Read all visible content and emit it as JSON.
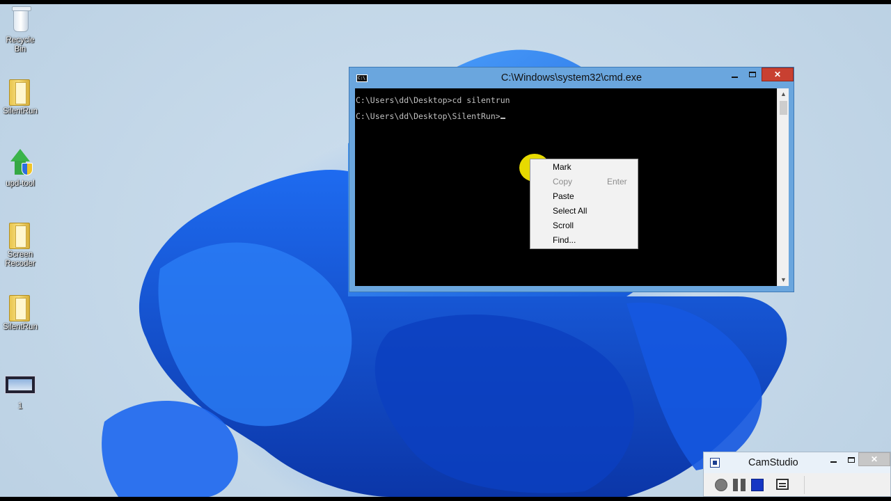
{
  "desktop": {
    "icons": [
      {
        "label": "Recycle Bin",
        "icon": "recycle-bin-icon"
      },
      {
        "label": "SilentRun",
        "icon": "folder-icon"
      },
      {
        "label": "upd-tool",
        "icon": "update-shield-icon"
      },
      {
        "label": "Screen Recoder",
        "icon": "folder-icon"
      },
      {
        "label": "SilentRun",
        "icon": "folder-icon"
      },
      {
        "label": "1",
        "icon": "video-file-icon"
      }
    ]
  },
  "cmd": {
    "title": "C:\\Windows\\system32\\cmd.exe",
    "icon": "cmd-icon",
    "lines": [
      "C:\\Users\\dd\\Desktop>cd silentrun",
      "C:\\Users\\dd\\Desktop\\SilentRun>"
    ],
    "close_glyph": "✕",
    "scroll_up": "▲",
    "scroll_down": "▼"
  },
  "context_menu": {
    "items": [
      {
        "label": "Mark",
        "accel": "",
        "enabled": true
      },
      {
        "label": "Copy",
        "accel": "Enter",
        "enabled": false
      },
      {
        "label": "Paste",
        "accel": "",
        "enabled": true
      },
      {
        "label": "Select All",
        "accel": "",
        "enabled": true
      },
      {
        "label": "Scroll",
        "accel": "",
        "enabled": true
      },
      {
        "label": "Find...",
        "accel": "",
        "enabled": true
      }
    ]
  },
  "camstudio": {
    "title": "CamStudio",
    "close_glyph": "✕",
    "tools": [
      "record-icon",
      "pause-icon",
      "stop-icon",
      "options-icon"
    ]
  },
  "colors": {
    "accent": "#6aa6de",
    "close_red": "#c84031",
    "highlight": "#f3e600"
  }
}
